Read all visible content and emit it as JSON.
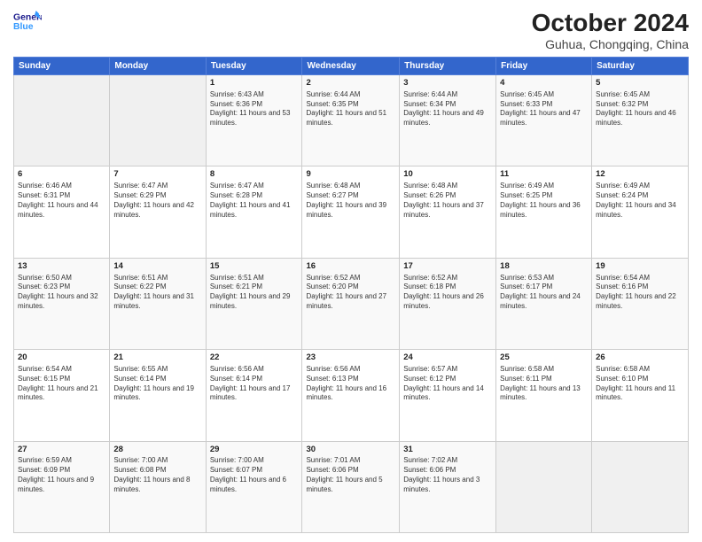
{
  "header": {
    "logo_line1": "General",
    "logo_line2": "Blue",
    "title": "October 2024",
    "location": "Guhua, Chongqing, China"
  },
  "weekdays": [
    "Sunday",
    "Monday",
    "Tuesday",
    "Wednesday",
    "Thursday",
    "Friday",
    "Saturday"
  ],
  "weeks": [
    [
      {
        "day": null,
        "sunrise": null,
        "sunset": null,
        "daylight": null
      },
      {
        "day": null,
        "sunrise": null,
        "sunset": null,
        "daylight": null
      },
      {
        "day": "1",
        "sunrise": "Sunrise: 6:43 AM",
        "sunset": "Sunset: 6:36 PM",
        "daylight": "Daylight: 11 hours and 53 minutes."
      },
      {
        "day": "2",
        "sunrise": "Sunrise: 6:44 AM",
        "sunset": "Sunset: 6:35 PM",
        "daylight": "Daylight: 11 hours and 51 minutes."
      },
      {
        "day": "3",
        "sunrise": "Sunrise: 6:44 AM",
        "sunset": "Sunset: 6:34 PM",
        "daylight": "Daylight: 11 hours and 49 minutes."
      },
      {
        "day": "4",
        "sunrise": "Sunrise: 6:45 AM",
        "sunset": "Sunset: 6:33 PM",
        "daylight": "Daylight: 11 hours and 47 minutes."
      },
      {
        "day": "5",
        "sunrise": "Sunrise: 6:45 AM",
        "sunset": "Sunset: 6:32 PM",
        "daylight": "Daylight: 11 hours and 46 minutes."
      }
    ],
    [
      {
        "day": "6",
        "sunrise": "Sunrise: 6:46 AM",
        "sunset": "Sunset: 6:31 PM",
        "daylight": "Daylight: 11 hours and 44 minutes."
      },
      {
        "day": "7",
        "sunrise": "Sunrise: 6:47 AM",
        "sunset": "Sunset: 6:29 PM",
        "daylight": "Daylight: 11 hours and 42 minutes."
      },
      {
        "day": "8",
        "sunrise": "Sunrise: 6:47 AM",
        "sunset": "Sunset: 6:28 PM",
        "daylight": "Daylight: 11 hours and 41 minutes."
      },
      {
        "day": "9",
        "sunrise": "Sunrise: 6:48 AM",
        "sunset": "Sunset: 6:27 PM",
        "daylight": "Daylight: 11 hours and 39 minutes."
      },
      {
        "day": "10",
        "sunrise": "Sunrise: 6:48 AM",
        "sunset": "Sunset: 6:26 PM",
        "daylight": "Daylight: 11 hours and 37 minutes."
      },
      {
        "day": "11",
        "sunrise": "Sunrise: 6:49 AM",
        "sunset": "Sunset: 6:25 PM",
        "daylight": "Daylight: 11 hours and 36 minutes."
      },
      {
        "day": "12",
        "sunrise": "Sunrise: 6:49 AM",
        "sunset": "Sunset: 6:24 PM",
        "daylight": "Daylight: 11 hours and 34 minutes."
      }
    ],
    [
      {
        "day": "13",
        "sunrise": "Sunrise: 6:50 AM",
        "sunset": "Sunset: 6:23 PM",
        "daylight": "Daylight: 11 hours and 32 minutes."
      },
      {
        "day": "14",
        "sunrise": "Sunrise: 6:51 AM",
        "sunset": "Sunset: 6:22 PM",
        "daylight": "Daylight: 11 hours and 31 minutes."
      },
      {
        "day": "15",
        "sunrise": "Sunrise: 6:51 AM",
        "sunset": "Sunset: 6:21 PM",
        "daylight": "Daylight: 11 hours and 29 minutes."
      },
      {
        "day": "16",
        "sunrise": "Sunrise: 6:52 AM",
        "sunset": "Sunset: 6:20 PM",
        "daylight": "Daylight: 11 hours and 27 minutes."
      },
      {
        "day": "17",
        "sunrise": "Sunrise: 6:52 AM",
        "sunset": "Sunset: 6:18 PM",
        "daylight": "Daylight: 11 hours and 26 minutes."
      },
      {
        "day": "18",
        "sunrise": "Sunrise: 6:53 AM",
        "sunset": "Sunset: 6:17 PM",
        "daylight": "Daylight: 11 hours and 24 minutes."
      },
      {
        "day": "19",
        "sunrise": "Sunrise: 6:54 AM",
        "sunset": "Sunset: 6:16 PM",
        "daylight": "Daylight: 11 hours and 22 minutes."
      }
    ],
    [
      {
        "day": "20",
        "sunrise": "Sunrise: 6:54 AM",
        "sunset": "Sunset: 6:15 PM",
        "daylight": "Daylight: 11 hours and 21 minutes."
      },
      {
        "day": "21",
        "sunrise": "Sunrise: 6:55 AM",
        "sunset": "Sunset: 6:14 PM",
        "daylight": "Daylight: 11 hours and 19 minutes."
      },
      {
        "day": "22",
        "sunrise": "Sunrise: 6:56 AM",
        "sunset": "Sunset: 6:14 PM",
        "daylight": "Daylight: 11 hours and 17 minutes."
      },
      {
        "day": "23",
        "sunrise": "Sunrise: 6:56 AM",
        "sunset": "Sunset: 6:13 PM",
        "daylight": "Daylight: 11 hours and 16 minutes."
      },
      {
        "day": "24",
        "sunrise": "Sunrise: 6:57 AM",
        "sunset": "Sunset: 6:12 PM",
        "daylight": "Daylight: 11 hours and 14 minutes."
      },
      {
        "day": "25",
        "sunrise": "Sunrise: 6:58 AM",
        "sunset": "Sunset: 6:11 PM",
        "daylight": "Daylight: 11 hours and 13 minutes."
      },
      {
        "day": "26",
        "sunrise": "Sunrise: 6:58 AM",
        "sunset": "Sunset: 6:10 PM",
        "daylight": "Daylight: 11 hours and 11 minutes."
      }
    ],
    [
      {
        "day": "27",
        "sunrise": "Sunrise: 6:59 AM",
        "sunset": "Sunset: 6:09 PM",
        "daylight": "Daylight: 11 hours and 9 minutes."
      },
      {
        "day": "28",
        "sunrise": "Sunrise: 7:00 AM",
        "sunset": "Sunset: 6:08 PM",
        "daylight": "Daylight: 11 hours and 8 minutes."
      },
      {
        "day": "29",
        "sunrise": "Sunrise: 7:00 AM",
        "sunset": "Sunset: 6:07 PM",
        "daylight": "Daylight: 11 hours and 6 minutes."
      },
      {
        "day": "30",
        "sunrise": "Sunrise: 7:01 AM",
        "sunset": "Sunset: 6:06 PM",
        "daylight": "Daylight: 11 hours and 5 minutes."
      },
      {
        "day": "31",
        "sunrise": "Sunrise: 7:02 AM",
        "sunset": "Sunset: 6:06 PM",
        "daylight": "Daylight: 11 hours and 3 minutes."
      },
      {
        "day": null,
        "sunrise": null,
        "sunset": null,
        "daylight": null
      },
      {
        "day": null,
        "sunrise": null,
        "sunset": null,
        "daylight": null
      }
    ]
  ]
}
